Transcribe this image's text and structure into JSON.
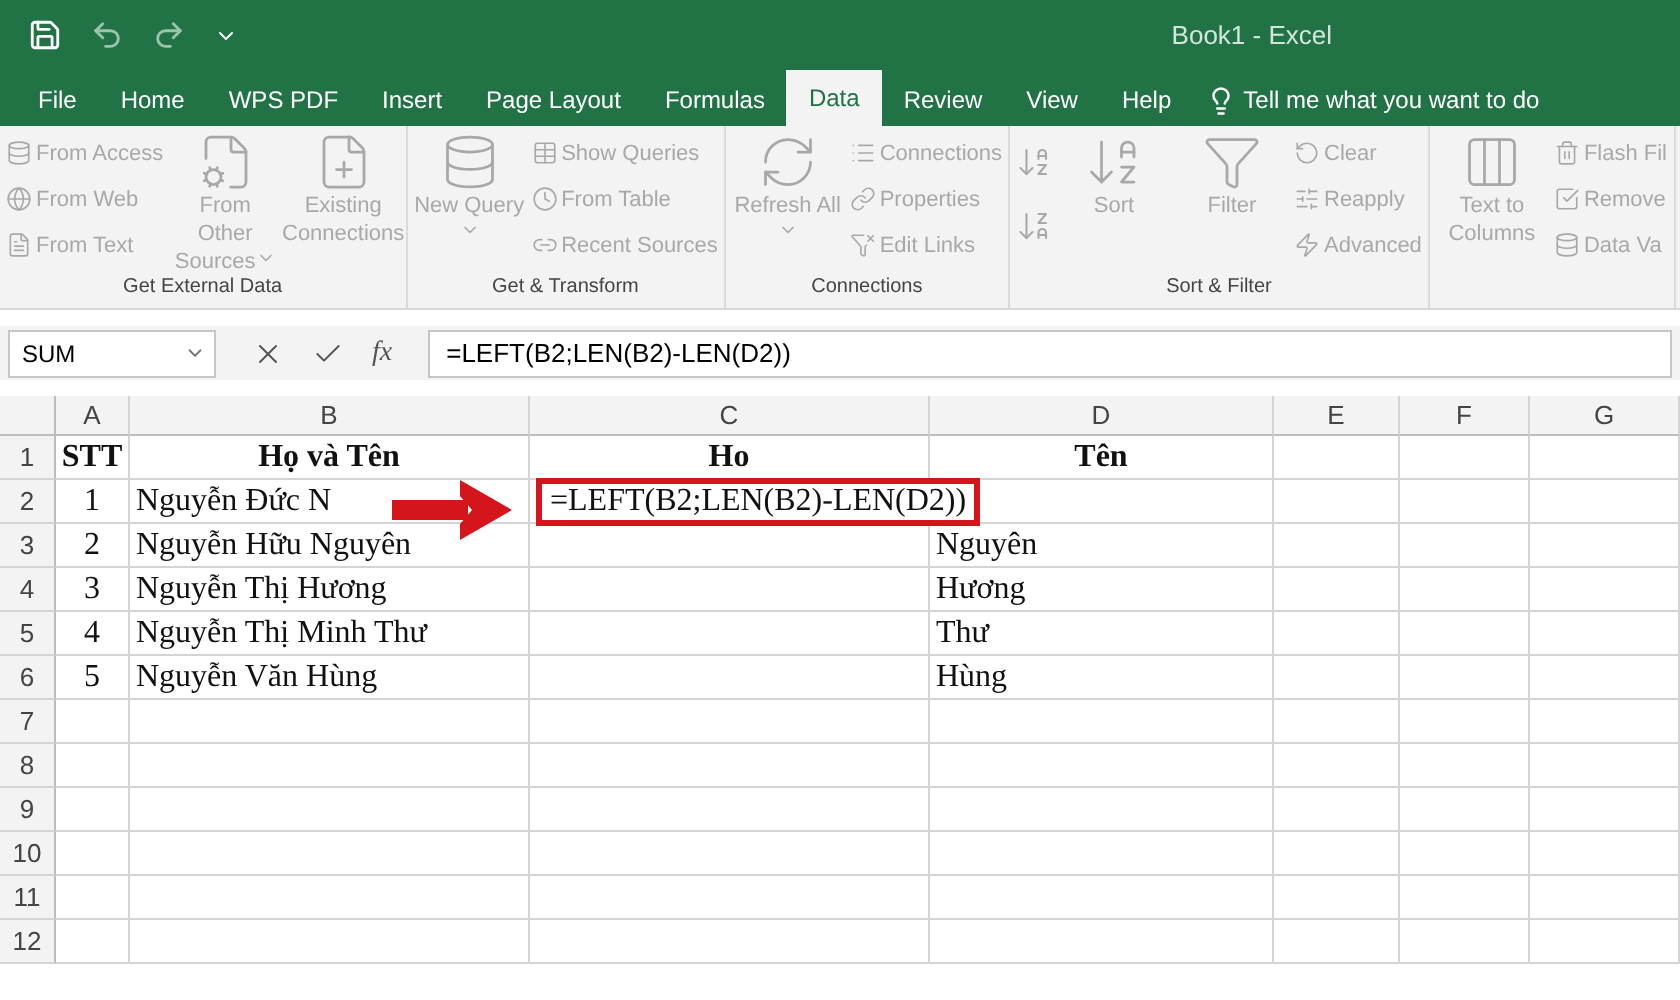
{
  "title_bar": {
    "title": "Book1  -  Excel"
  },
  "menu_tabs": [
    {
      "label": "File",
      "selected": false
    },
    {
      "label": "Home",
      "selected": false
    },
    {
      "label": "WPS PDF",
      "selected": false
    },
    {
      "label": "Insert",
      "selected": false
    },
    {
      "label": "Page Layout",
      "selected": false
    },
    {
      "label": "Formulas",
      "selected": false
    },
    {
      "label": "Data",
      "selected": true
    },
    {
      "label": "Review",
      "selected": false
    },
    {
      "label": "View",
      "selected": false
    },
    {
      "label": "Help",
      "selected": false
    }
  ],
  "tell_me": {
    "placeholder": "Tell me what you want to do"
  },
  "ribbon": {
    "groups": [
      {
        "label": "Get External Data",
        "items": [
          {
            "kind": "small",
            "label": "From Access",
            "disabled": true
          },
          {
            "kind": "small",
            "label": "From Web",
            "disabled": true
          },
          {
            "kind": "small",
            "label": "From Text",
            "disabled": true
          },
          {
            "kind": "large",
            "label": "From Other Sources",
            "dropdown": true,
            "disabled": true
          },
          {
            "kind": "large",
            "label": "Existing Connections",
            "dropdown": false,
            "disabled": true
          }
        ]
      },
      {
        "label": "Get & Transform",
        "items": [
          {
            "kind": "large",
            "label": "New Query",
            "dropdown": true,
            "disabled": true
          },
          {
            "kind": "small",
            "label": "Show Queries",
            "disabled": true
          },
          {
            "kind": "small",
            "label": "From Table",
            "disabled": true
          },
          {
            "kind": "small",
            "label": "Recent Sources",
            "disabled": true
          }
        ]
      },
      {
        "label": "Connections",
        "items": [
          {
            "kind": "large",
            "label": "Refresh All",
            "dropdown": true,
            "disabled": true
          },
          {
            "kind": "small",
            "label": "Connections",
            "disabled": true
          },
          {
            "kind": "small",
            "label": "Properties",
            "disabled": true
          },
          {
            "kind": "small",
            "label": "Edit Links",
            "disabled": true
          }
        ]
      },
      {
        "label": "Sort & Filter",
        "items": [
          {
            "kind": "sort_pair",
            "disabled": true
          },
          {
            "kind": "large",
            "label": "Sort",
            "dropdown": false,
            "disabled": true
          },
          {
            "kind": "large",
            "label": "Filter",
            "dropdown": false,
            "disabled": true
          },
          {
            "kind": "small",
            "label": "Clear",
            "disabled": true
          },
          {
            "kind": "small",
            "label": "Reapply",
            "disabled": true
          },
          {
            "kind": "small",
            "label": "Advanced",
            "disabled": true
          }
        ]
      },
      {
        "items": [
          {
            "kind": "large",
            "label": "Text to Columns",
            "dropdown": false,
            "disabled": true
          },
          {
            "kind": "small",
            "label": "Flash Fil",
            "disabled": true
          },
          {
            "kind": "small",
            "label": "Remove",
            "disabled": true
          },
          {
            "kind": "small",
            "label": "Data Va",
            "disabled": true
          }
        ]
      }
    ]
  },
  "formula_bar": {
    "name_box": "SUM",
    "fx": "fx",
    "formula": "=LEFT(B2;LEN(B2)-LEN(D2))"
  },
  "sheet": {
    "columns": [
      "A",
      "B",
      "C",
      "D",
      "E",
      "F",
      "G"
    ],
    "rows": [
      {
        "number": "1",
        "kind": "header",
        "cells": [
          {
            "text": "STT"
          },
          {
            "text": "Họ và Tên"
          },
          {
            "text": "Ho"
          },
          {
            "text": "Tên"
          }
        ]
      },
      {
        "number": "2",
        "kind": "data",
        "cells": [
          {
            "text": "1"
          },
          {
            "text": "Nguyễn Đức N"
          },
          {
            "text": "=LEFT(B2;LEN(B2)-LEN(D2))",
            "editing": true
          },
          null
        ]
      },
      {
        "number": "3",
        "kind": "data",
        "cells": [
          {
            "text": "2"
          },
          {
            "text": "Nguyễn Hữu Nguyên"
          },
          null,
          {
            "text": "Nguyên"
          }
        ]
      },
      {
        "number": "4",
        "kind": "data",
        "cells": [
          {
            "text": "3"
          },
          {
            "text": "Nguyễn Thị Hương"
          },
          null,
          {
            "text": "Hương"
          }
        ]
      },
      {
        "number": "5",
        "kind": "data",
        "cells": [
          {
            "text": "4"
          },
          {
            "text": "Nguyễn Thị Minh Thư"
          },
          null,
          {
            "text": "Thư"
          }
        ]
      },
      {
        "number": "6",
        "kind": "data",
        "cells": [
          {
            "text": "5"
          },
          {
            "text": "Nguyễn Văn Hùng"
          },
          null,
          {
            "text": "Hùng"
          }
        ]
      },
      {
        "number": "7",
        "kind": "data",
        "cells": []
      },
      {
        "number": "8",
        "kind": "data",
        "cells": []
      },
      {
        "number": "9",
        "kind": "data",
        "cells": []
      },
      {
        "number": "10",
        "kind": "data",
        "cells": []
      },
      {
        "number": "11",
        "kind": "data",
        "cells": []
      },
      {
        "number": "12",
        "kind": "data",
        "cells": []
      }
    ]
  }
}
